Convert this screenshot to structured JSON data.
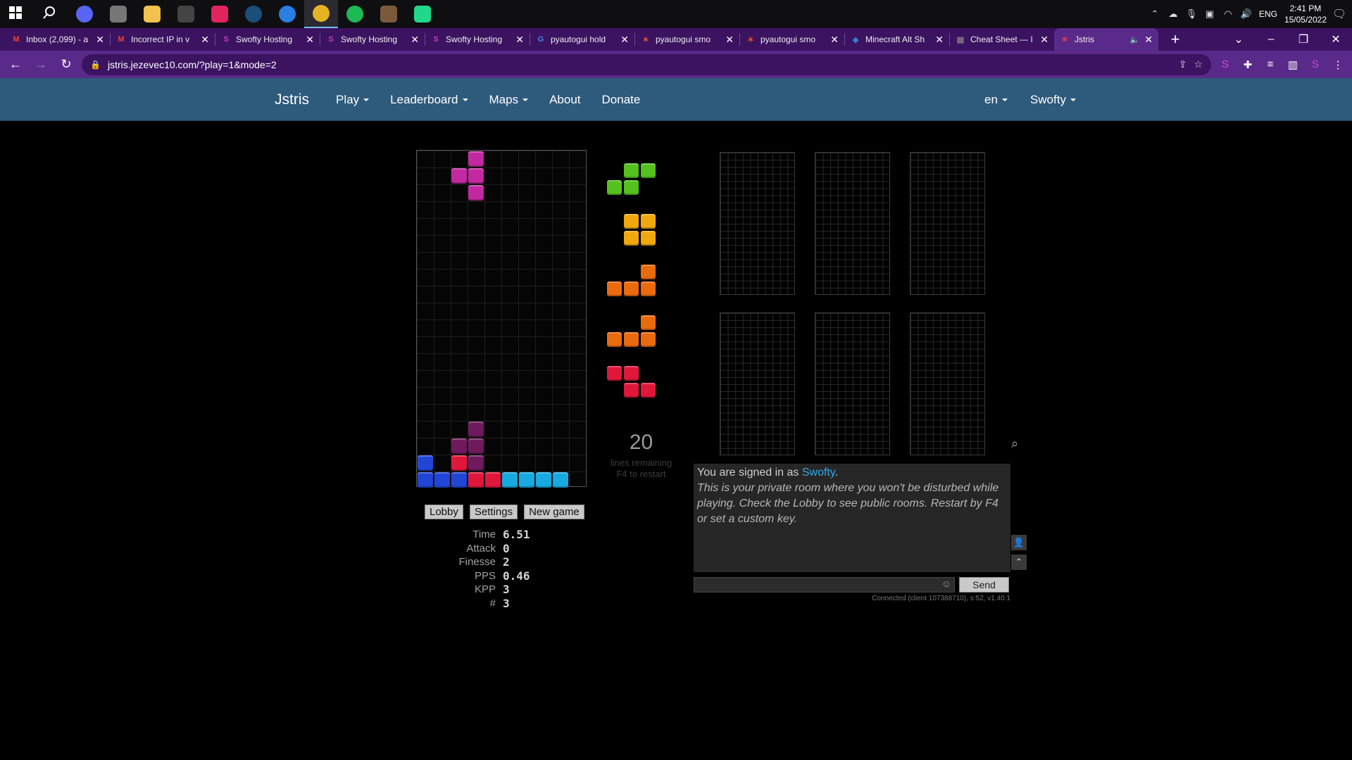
{
  "taskbar": {
    "apps": [
      {
        "name": "windows-start",
        "color": "#ffffff"
      },
      {
        "name": "search",
        "color": "#ffffff"
      },
      {
        "name": "discord",
        "color": "#5865f2"
      },
      {
        "name": "app-gray",
        "color": "#777777"
      },
      {
        "name": "file-explorer",
        "color": "#f2c14e"
      },
      {
        "name": "terminal",
        "color": "#444444"
      },
      {
        "name": "intellij",
        "color": "#e0245e"
      },
      {
        "name": "steam",
        "color": "#1b4f7a"
      },
      {
        "name": "bluetooth-app",
        "color": "#2a7de1"
      },
      {
        "name": "chrome",
        "color": "#e6b323"
      },
      {
        "name": "spotify",
        "color": "#1db954"
      },
      {
        "name": "minecraft",
        "color": "#7a5a3a"
      },
      {
        "name": "pycharm",
        "color": "#21d789"
      }
    ],
    "lang": "ENG",
    "time": "2:41 PM",
    "date": "15/05/2022"
  },
  "browser": {
    "tabs": [
      {
        "title": "Inbox (2,099) - a",
        "fav": "M",
        "favColor": "#ea4335"
      },
      {
        "title": "Incorrect IP in v",
        "fav": "M",
        "favColor": "#ea4335"
      },
      {
        "title": "Swofty Hosting",
        "fav": "S",
        "favColor": "#c23cbf"
      },
      {
        "title": "Swofty Hosting",
        "fav": "S",
        "favColor": "#c23cbf"
      },
      {
        "title": "Swofty Hosting",
        "fav": "S",
        "favColor": "#c23cbf"
      },
      {
        "title": "pyautogui hold",
        "fav": "G",
        "favColor": "#4285f4"
      },
      {
        "title": "pyautogui smo",
        "fav": "✶",
        "favColor": "#e94f2b"
      },
      {
        "title": "pyautogui smo",
        "fav": "✶",
        "favColor": "#e94f2b"
      },
      {
        "title": "Minecraft Alt Sh",
        "fav": "◆",
        "favColor": "#3a7bd5"
      },
      {
        "title": "Cheat Sheet — I",
        "fav": "▤",
        "favColor": "#888888"
      },
      {
        "title": "Jstris",
        "fav": "■",
        "favColor": "#d9344f",
        "active": true
      }
    ],
    "url": "jstris.jezevec10.com/?play=1&mode=2"
  },
  "site_nav": {
    "brand": "Jstris",
    "play": "Play",
    "leaderboard": "Leaderboard",
    "maps": "Maps",
    "about": "About",
    "donate": "Donate",
    "lang": "en",
    "user": "Swofty"
  },
  "game": {
    "lines_remaining": "20",
    "lines_label": "lines remaining",
    "restart_hint": "F4 to restart",
    "buttons": {
      "lobby": "Lobby",
      "settings": "Settings",
      "new_game": "New game"
    },
    "stats": [
      {
        "label": "Time",
        "value": "6.51"
      },
      {
        "label": "Attack",
        "value": "0"
      },
      {
        "label": "Finesse",
        "value": "2"
      },
      {
        "label": "PPS",
        "value": "0.46"
      },
      {
        "label": "KPP",
        "value": "3"
      },
      {
        "label": "#",
        "value": "3"
      }
    ],
    "colors": {
      "T": "#c2289f",
      "Tdark": "#6e1a5c",
      "J": "#2145d4",
      "Z": "#e0173b",
      "I": "#17a9e0",
      "S": "#55c11e",
      "O": "#f1a80f",
      "L": "#ea6a0e"
    },
    "queue": [
      "S",
      "O",
      "L",
      "L",
      "Z"
    ]
  },
  "chat": {
    "signed_prefix": "You are signed in as ",
    "user": "Swofty",
    "signed_suffix": ".",
    "info": "This is your private room where you won't be disturbed while playing. Check the Lobby to see public rooms. Restart by F4 or set a custom key.",
    "send": "Send",
    "connection": "Connected (client 107388710), s:52, v1.40.1"
  }
}
